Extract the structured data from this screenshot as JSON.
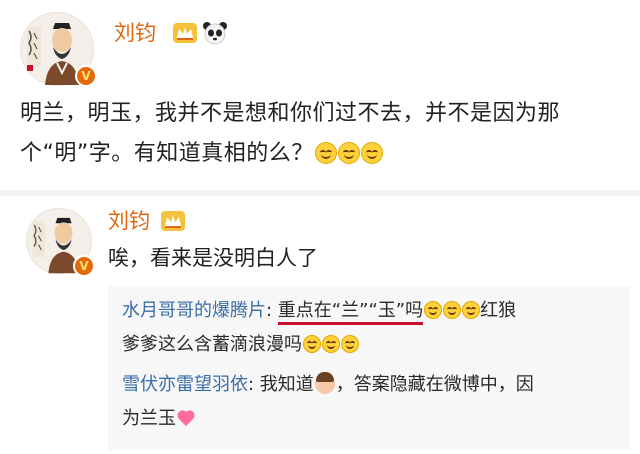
{
  "post": {
    "author": "刘钧",
    "line1": "明兰，明玉，我并不是想和你们过不去，并不是因为那",
    "line2": "个“明”字。有知道真相的么？"
  },
  "comment": {
    "author": "刘钧",
    "text": "唉，看来是没明白人了"
  },
  "replies": [
    {
      "user": "水月哥哥的爆腾片",
      "sep": ": ",
      "highlight": "重点在“兰”“玉”吗",
      "tail": "红狼",
      "line2": "爹爹这么含蓄滴浪漫吗"
    },
    {
      "user": "雪伏亦雷望羽依",
      "sep": ": ",
      "text1": "我知道",
      "text2": "，答案隐藏在微博中，因",
      "line2": "为兰玉"
    }
  ],
  "icons": {
    "vip": "crown-icon",
    "panda": "panda-icon",
    "verified": "verified-v-icon",
    "smile": "smile-emoji-icon",
    "woman": "woman-emoji-icon",
    "heart": "heart-emoji-icon"
  },
  "colors": {
    "name": "#e0660f",
    "reply_user": "#3b6ea8",
    "underline": "#c8102e",
    "quote_bg": "#f7f7f7"
  },
  "verified_glyph": "V"
}
